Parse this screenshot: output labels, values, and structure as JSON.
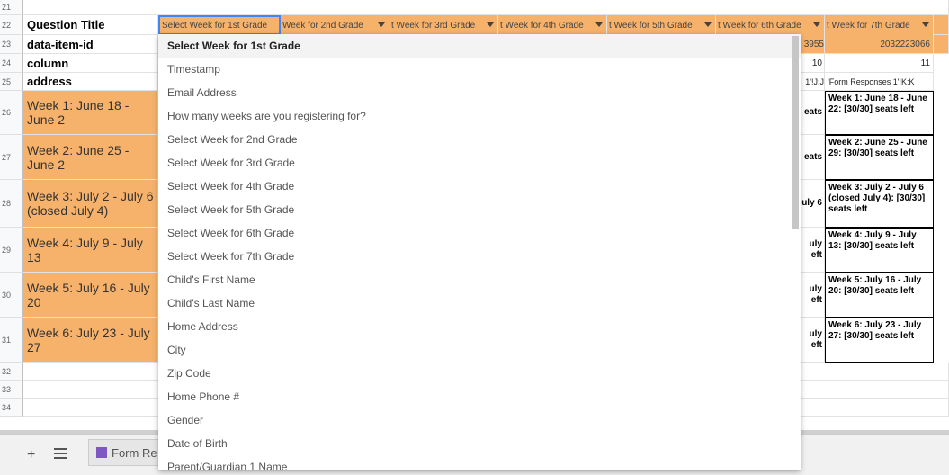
{
  "row_numbers": [
    "21",
    "22",
    "23",
    "24",
    "25",
    "26",
    "27",
    "28",
    "29",
    "30",
    "31",
    "32",
    "33",
    "34"
  ],
  "row_labels": {
    "question_title": "Question Title",
    "data_item_id": "data-item-id",
    "column": "column",
    "address": "address"
  },
  "week_rows": [
    "Week 1: June 18 - June 2",
    "Week 2: June 25 - June 2",
    "Week 3: July 2 - July 6 (closed July 4)",
    "Week 4: July 9 - July 13",
    "Week 5: July 16 - July 20",
    "Week 6: July 23 - July 27"
  ],
  "column_headers": [
    "Select Week for 1st Grade",
    "Week for 2nd Grade",
    "t Week for 3rd Grade",
    "t Week for 4th Grade",
    "t Week for 5th Grade",
    "t Week for 6th Grade",
    "t Week for 7th Grade"
  ],
  "data_item_ids": {
    "partial": "3955",
    "full": "2032223066"
  },
  "column_values": {
    "partial": "10",
    "full": "11"
  },
  "address_values": {
    "partial": "1'!J:J",
    "full": "'Form Responses 1'!K:K"
  },
  "partial_cells": [
    [
      "eats"
    ],
    [
      "eats"
    ],
    [
      "uly 6"
    ],
    [
      "uly",
      "eft"
    ],
    [
      "uly",
      "eft"
    ],
    [
      "uly",
      "eft"
    ]
  ],
  "last_col_cells": [
    "Week 1: June 18 - June 22:  [30/30] seats left",
    "Week 2: June 25 - June 29:  [30/30] seats left",
    "Week 3: July 2 - July 6 (closed July 4): [30/30] seats left",
    "Week 4: July 9 - July 13:  [30/30] seats left",
    "Week 5: July 16 - July 20:  [30/30] seats left",
    "Week 6: July 23 - July 27:  [30/30] seats left"
  ],
  "dropdown": {
    "items": [
      "Select Week for 1st Grade",
      "Timestamp",
      "Email Address",
      "How many weeks are you registering for?",
      "Select Week for 2nd Grade",
      "Select Week for 3rd Grade",
      "Select Week for 4th Grade",
      "Select Week for 5th Grade",
      "Select Week for 6th Grade",
      "Select Week for 7th Grade",
      "Child's First Name",
      "Child's Last Name",
      "Home Address",
      "City",
      "Zip Code",
      "Home Phone #",
      "Gender",
      "Date of Birth",
      "Parent/Guardian 1 Name"
    ]
  },
  "bottom": {
    "add_label": "+",
    "sheet_tab": "Form Re"
  },
  "colors": {
    "header_orange": "#f6b26b",
    "selection_blue": "#4285f4",
    "tab_icon": "#7e57c2"
  }
}
